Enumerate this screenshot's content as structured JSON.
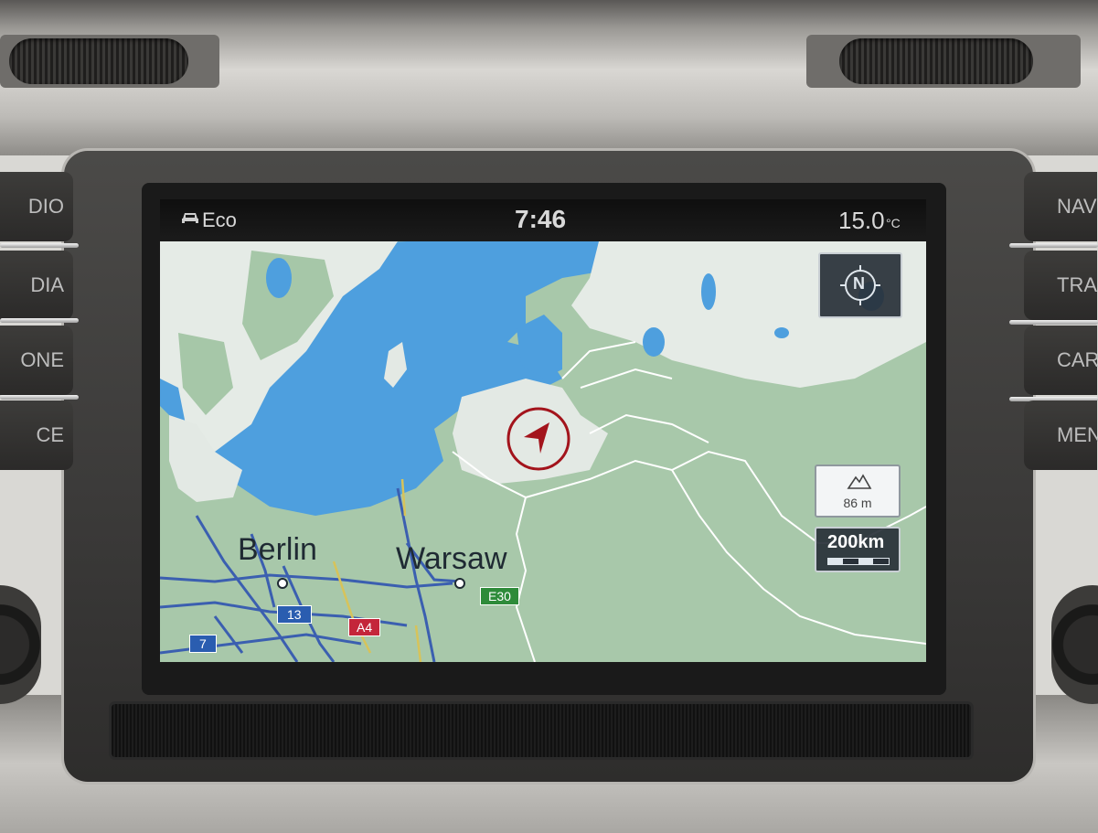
{
  "statusbar": {
    "left_label": "Eco",
    "time": "7:46",
    "temperature": "15.0",
    "temperature_unit": "°C"
  },
  "side_buttons_left": [
    "DIO",
    "DIA",
    "ONE",
    "CE"
  ],
  "side_buttons_right": [
    "NAV",
    "TRAF",
    "CAR",
    "MEN"
  ],
  "map": {
    "cities": [
      {
        "name": "Berlin"
      },
      {
        "name": "Warsaw"
      }
    ],
    "road_shields": [
      {
        "label": "E30",
        "color": "#2e8b3a"
      },
      {
        "label": "13",
        "color": "#2a5db0"
      },
      {
        "label": "A4",
        "color": "#c4263a"
      },
      {
        "label": "7",
        "color": "#2a5db0"
      }
    ],
    "elevation": "86 m",
    "scale": "200km",
    "compass_label": "N"
  },
  "colors": {
    "water": "#4e9fde",
    "land": "#a6c7a8",
    "land_light": "#e3e9e4",
    "roads": "#3b5fb0",
    "cursor": "#a3141c"
  }
}
